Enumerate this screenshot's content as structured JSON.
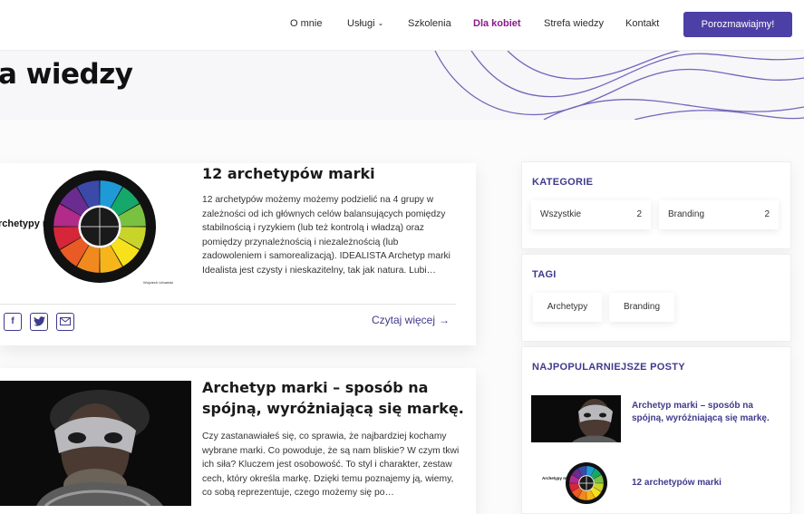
{
  "nav": {
    "items": [
      "O mnie",
      "Usługi",
      "Szkolenia",
      "Dla kobiet",
      "Strefa wiedzy",
      "Kontakt"
    ],
    "cta": "Porozmawiajmy!",
    "colors": {
      "accent": "#4c40a6",
      "active": "#8a1a8c"
    }
  },
  "hero": {
    "title": "a wiedzy"
  },
  "posts": [
    {
      "title": "12 archetypów marki",
      "excerpt": "12 archetypów możemy możemy podzielić na 4 grupy w zależności od ich głównych celów balansujących pomiędzy stabilnością i ryzykiem (lub też kontrolą i władzą) oraz pomiędzy przynależnością i niezależnością (lub zadowoleniem i samorealizacją). IDEALISTA Archetyp marki Idealista jest czysty i nieskazitelny, tak jak natura. Lubi…",
      "image_label": "rchetypy marek",
      "image_caption": "Wojciech Urbański",
      "read_more": "Czytaj więcej",
      "share_icons": [
        "facebook-icon",
        "twitter-icon",
        "email-icon"
      ]
    },
    {
      "title": "Archetyp marki – sposób na spójną, wyróżniającą się markę.",
      "excerpt": "Czy zastanawiałeś się, co sprawia, że najbardziej kochamy wybrane marki. Co powoduje, że są nam bliskie? W czym tkwi ich siła? Kluczem jest osobowość. To styl i charakter, zestaw cech, który określa markę. Dzięki temu poznajemy ją, wiemy, co sobą reprezentuje, czego możemy się po…"
    }
  ],
  "sidebar": {
    "categories": {
      "title": "KATEGORIE",
      "items": [
        {
          "label": "Wszystkie",
          "count": "2"
        },
        {
          "label": "Branding",
          "count": "2"
        }
      ]
    },
    "tags": {
      "title": "TAGI",
      "items": [
        "Archetypy",
        "Branding"
      ]
    },
    "popular": {
      "title": "NAJPOPULARNIEJSZE POSTY",
      "items": [
        {
          "title": "Archetyp marki – sposób na spójną, wyróżniającą się markę."
        },
        {
          "title": "12 archetypów marki",
          "thumb_label": "Archetypy marek"
        }
      ]
    }
  }
}
